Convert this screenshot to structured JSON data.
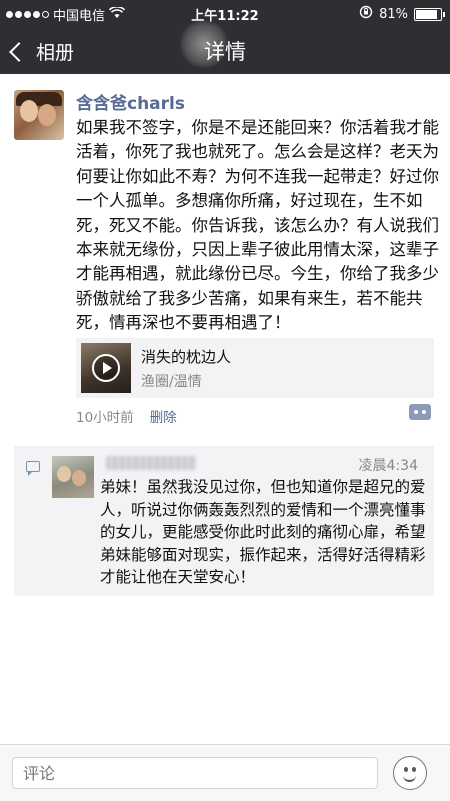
{
  "status_bar": {
    "carrier": "中国电信",
    "time": "上午11:22",
    "battery": "81%",
    "battery_level": 0.81
  },
  "nav": {
    "back_label": "相册",
    "title": "详情"
  },
  "post": {
    "username": "含含爸charls",
    "text": "如果我不签字，你是不是还能回来？你活着我才能活着，你死了我也就死了。怎么会是这样？老天为何要让你如此不寿？为何不连我一起带走？好过你一个人孤单。多想痛你所痛，好过现在，生不如死，死又不能。你告诉我，该怎么办？有人说我们本来就无缘份，只因上辈子彼此用情太深，这辈子才能再相遇，就此缘份已尽。今生，你给了我多少骄傲就给了我多少苦痛，如果有来生，若不能共死，情再深也不要再相遇了！",
    "share": {
      "title": "消失的枕边人",
      "subtitle": "渔圈/温情"
    },
    "time_ago": "10小时前",
    "delete_label": "删除"
  },
  "comment": {
    "time": "凌晨4:34",
    "text": "弟妹！虽然我没见过你，但也知道你是超兄的爱人，听说过你俩轰轰烈烈的爱情和一个漂亮懂事的女儿，更能感受你此时此刻的痛彻心扉，希望弟妹能够面对现实，振作起来，活得好活得精彩才能让他在天堂安心！"
  },
  "input": {
    "placeholder": "评论"
  }
}
